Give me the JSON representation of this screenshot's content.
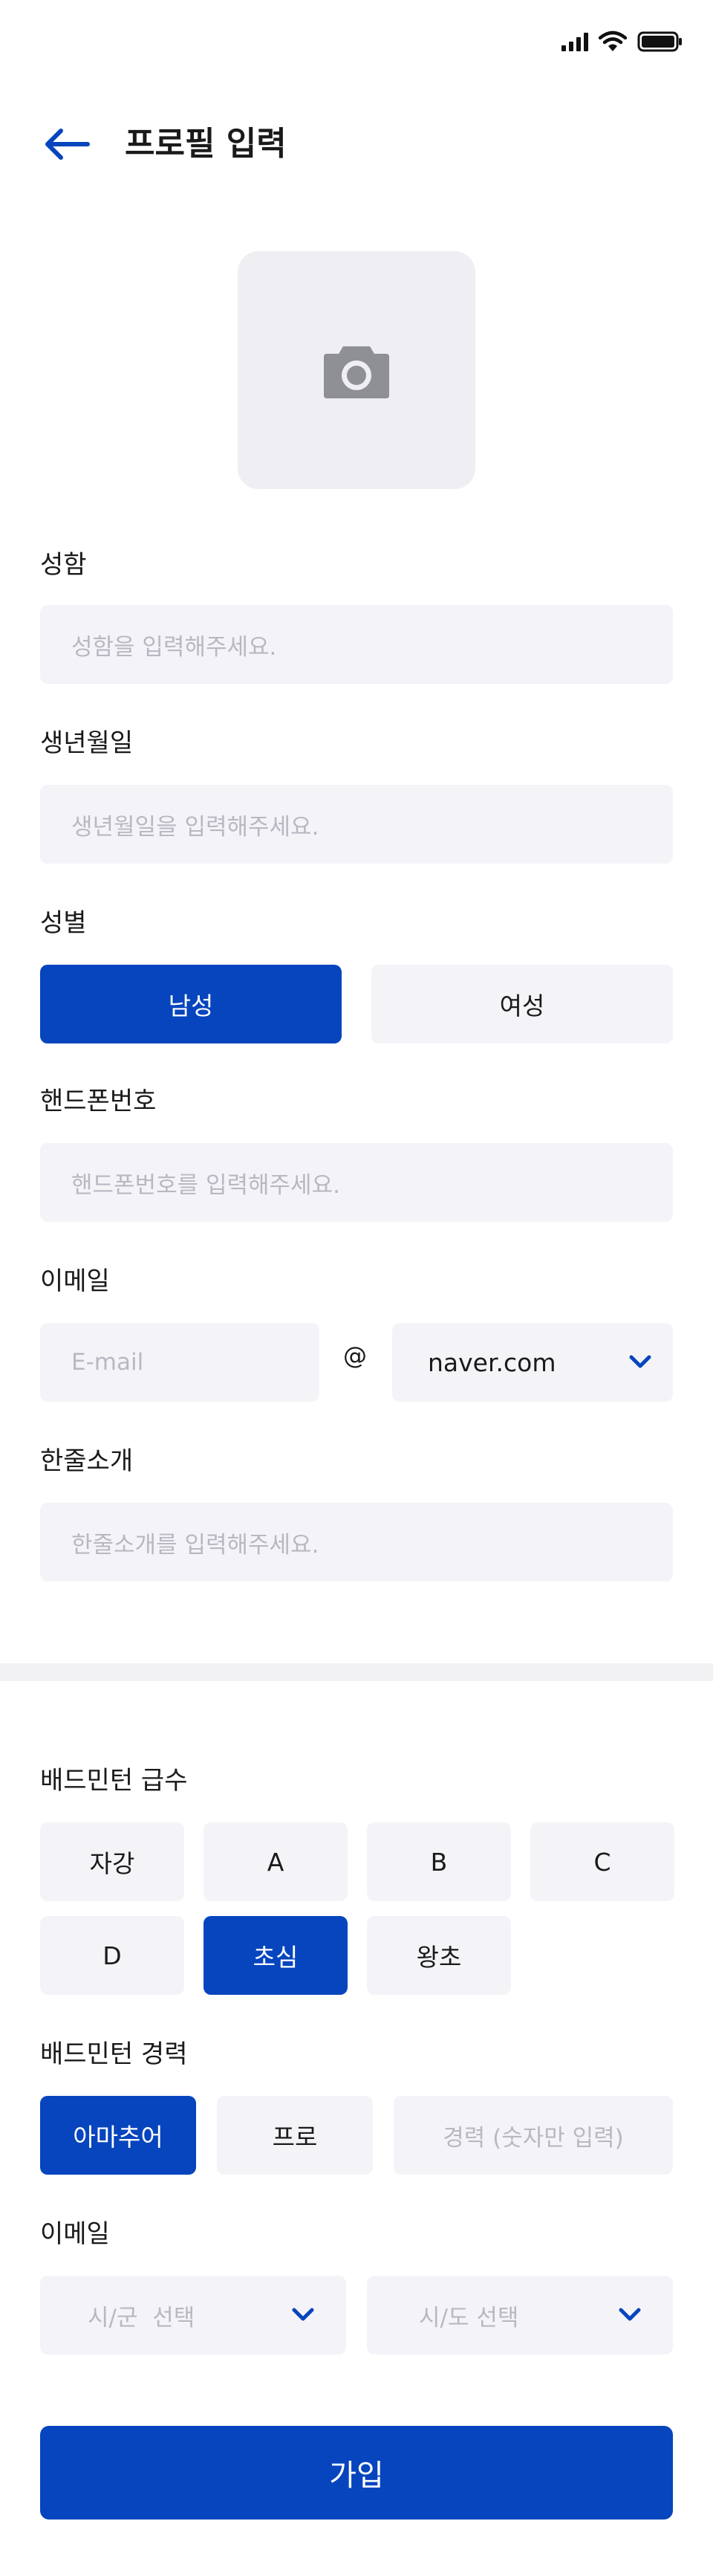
{
  "header": {
    "title": "프로필 입력"
  },
  "profile": {
    "name": {
      "label": "성함",
      "placeholder": "성함을 입력해주세요."
    },
    "birthdate": {
      "label": "생년월일",
      "placeholder": "생년월일을 입력해주세요."
    },
    "gender": {
      "label": "성별",
      "options": [
        "남성",
        "여성"
      ],
      "selected": "남성"
    },
    "phone": {
      "label": "핸드폰번호",
      "placeholder": "핸드폰번호를 입력해주세요."
    },
    "email": {
      "label": "이메일",
      "placeholder": "E-mail",
      "at": "@",
      "domain": "naver.com"
    },
    "intro": {
      "label": "한줄소개",
      "placeholder": "한줄소개를 입력해주세요."
    }
  },
  "badminton": {
    "grade": {
      "label": "배드민턴 급수",
      "options": [
        "자강",
        "A",
        "B",
        "C",
        "D",
        "초심",
        "왕초"
      ],
      "selected": "초심"
    },
    "career": {
      "label": "배드민턴 경력",
      "options": [
        "아마추어",
        "프로"
      ],
      "selected": "아마추어",
      "placeholder": "경력 (숫자만 입력)"
    },
    "region": {
      "label": "이메일",
      "city_placeholder": "시/군  선택",
      "province_placeholder": "시/도 선택"
    }
  },
  "submit_label": "가입",
  "colors": {
    "primary": "#0645bd",
    "field_bg": "#f4f4f8",
    "placeholder": "#b8b8c2"
  },
  "icons": [
    "signal-icon",
    "wifi-icon",
    "battery-icon",
    "back-arrow-icon",
    "camera-icon",
    "chevron-down-icon"
  ]
}
